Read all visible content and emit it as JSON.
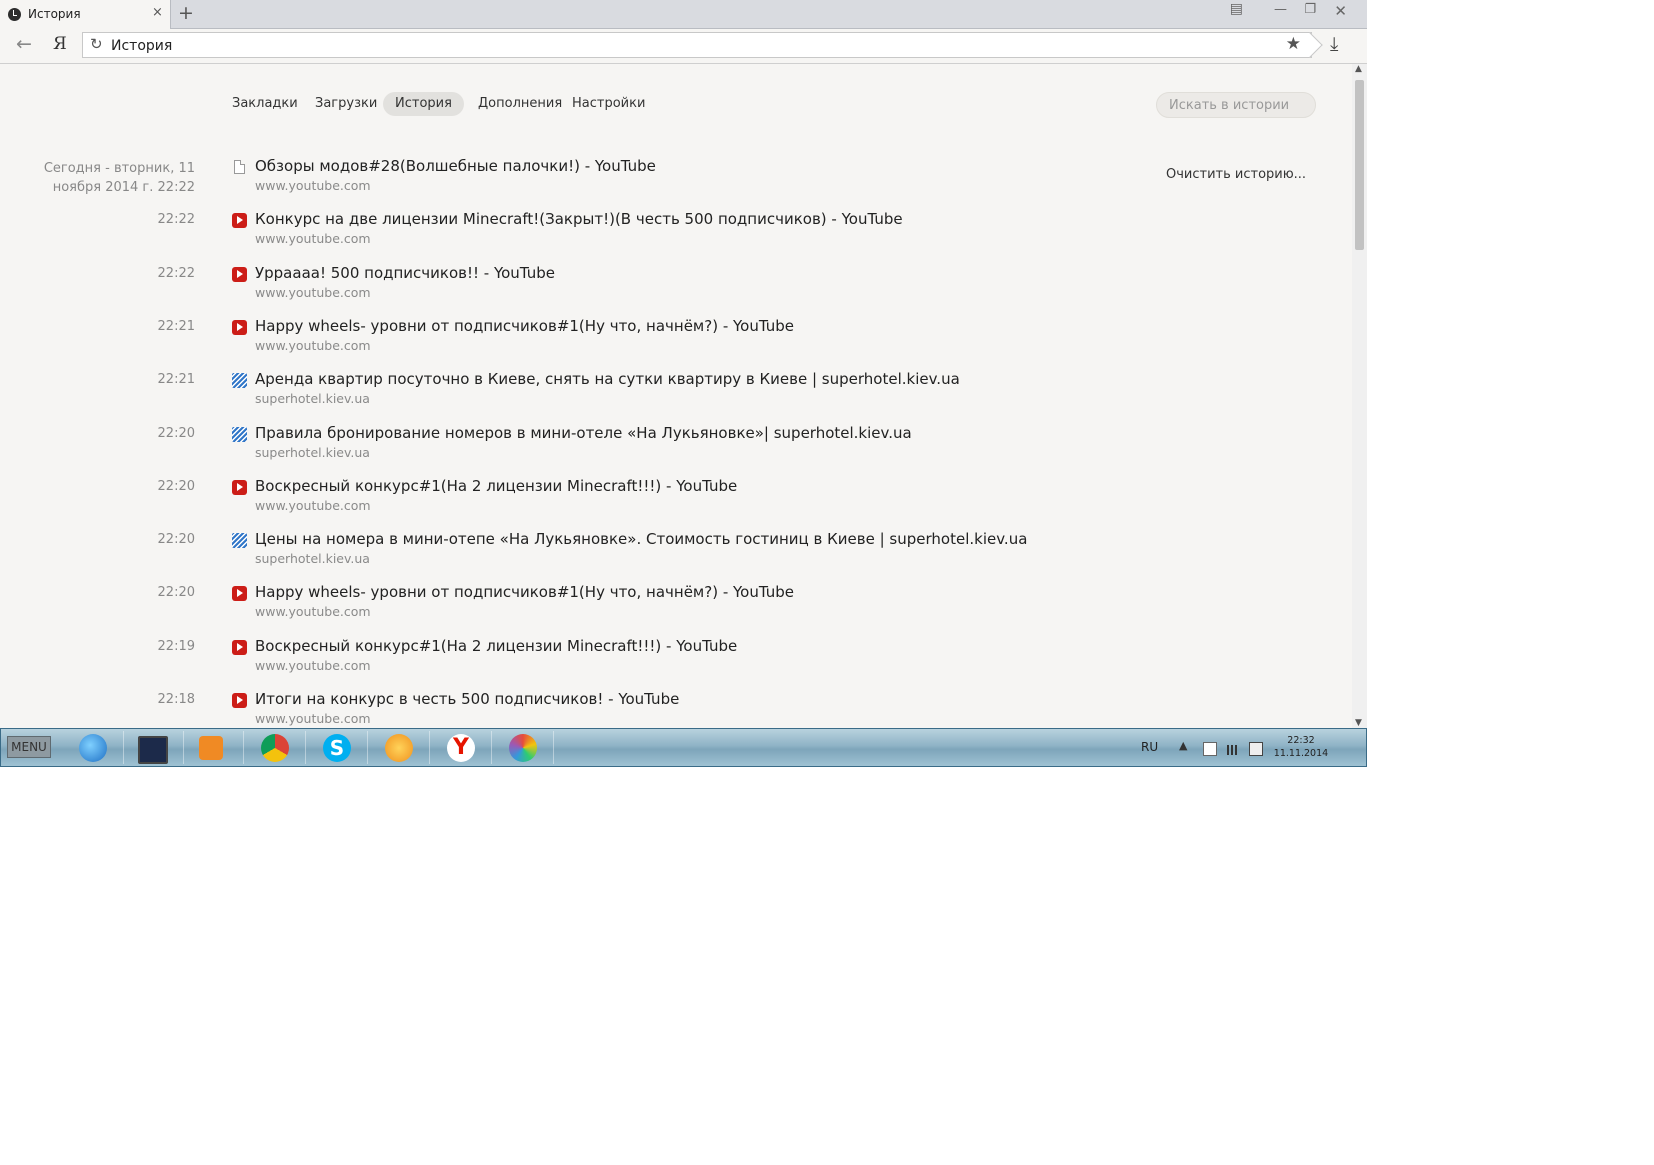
{
  "browser": {
    "tab": {
      "title": "История"
    },
    "address": "История"
  },
  "nav": {
    "links": [
      "Закладки",
      "Загрузки",
      "История",
      "Дополнения",
      "Настройки"
    ],
    "active": "История",
    "search_placeholder": "Искать в истории"
  },
  "history": {
    "clear_label": "Очистить историю...",
    "date_header": "Сегодня - вторник, 11 ноября 2014 г. 22:22",
    "entries": [
      {
        "time": "",
        "icon": "page-icon",
        "title": "Обзоры модов#28(Волшебные палочки!) - YouTube",
        "url": "www.youtube.com"
      },
      {
        "time": "22:22",
        "icon": "youtube-icon",
        "title": "Конкурс на две лицензии Minecraft!(Закрыт!)(В честь 500 подписчиков) - YouTube",
        "url": "www.youtube.com"
      },
      {
        "time": "22:22",
        "icon": "youtube-icon",
        "title": "Урраааа! 500 подписчиков!! - YouTube",
        "url": "www.youtube.com"
      },
      {
        "time": "22:21",
        "icon": "youtube-icon",
        "title": "Happy wheels- уровни от подписчиков#1(Ну что, начнём?) - YouTube",
        "url": "www.youtube.com"
      },
      {
        "time": "22:21",
        "icon": "superhotel-icon",
        "title": "Аренда квартир посуточно в Киеве, снять на сутки квартиру в Киеве | superhotel.kiev.ua",
        "url": "superhotel.kiev.ua"
      },
      {
        "time": "22:20",
        "icon": "superhotel-icon",
        "title": "Правила бронирование номеров в мини-отеле «На Лукьяновке»| superhotel.kiev.ua",
        "url": "superhotel.kiev.ua"
      },
      {
        "time": "22:20",
        "icon": "youtube-icon",
        "title": "Воскресный конкурс#1(На 2 лицензии Minecraft!!!) - YouTube",
        "url": "www.youtube.com"
      },
      {
        "time": "22:20",
        "icon": "superhotel-icon",
        "title": "Цены на номера в мини-отепе «На Лукьяновке». Стоимость гостиниц в Киеве | superhotel.kiev.ua",
        "url": "superhotel.kiev.ua"
      },
      {
        "time": "22:20",
        "icon": "youtube-icon",
        "title": "Happy wheels- уровни от подписчиков#1(Ну что, начнём?) - YouTube",
        "url": "www.youtube.com"
      },
      {
        "time": "22:19",
        "icon": "youtube-icon",
        "title": "Воскресный конкурс#1(На 2 лицензии Minecraft!!!) - YouTube",
        "url": "www.youtube.com"
      },
      {
        "time": "22:18",
        "icon": "youtube-icon",
        "title": "Итоги на конкурс в честь 500 подписчиков! - YouTube",
        "url": "www.youtube.com"
      }
    ]
  },
  "taskbar": {
    "menu_label": "MENU",
    "apps": [
      "internet-explorer-icon",
      "monitor-app-icon",
      "media-player-icon",
      "chrome-icon",
      "skype-icon",
      "game-app-icon",
      "yandex-browser-icon",
      "paint-icon"
    ],
    "tray": {
      "lang": "RU",
      "time": "22:32",
      "date": "11.11.2014"
    }
  },
  "colors": {
    "youtube": "#cc1d17",
    "superhotel": "#3277c8",
    "taskbar": "#8fb3c6"
  }
}
